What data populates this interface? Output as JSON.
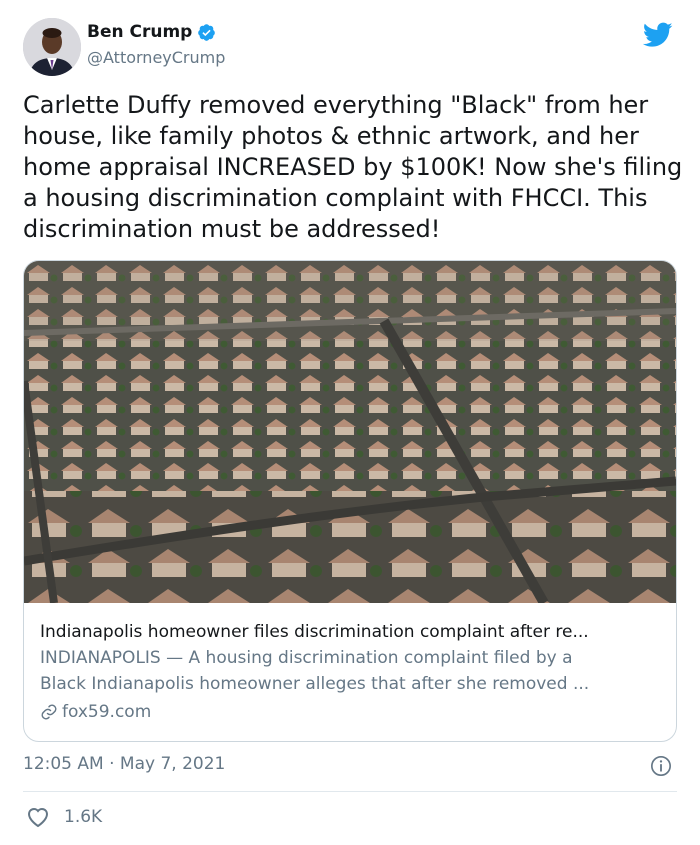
{
  "author": {
    "name": "Ben Crump",
    "handle": "@AttorneyCrump",
    "verified": true
  },
  "tweet": {
    "text": "Carlette Duffy removed everything \"Black\" from her house, like family photos & ethnic artwork, and her home appraisal INCREASED by $100K! Now she's filing a housing discrimination complaint with FHCCI. This discrimination must be addressed!"
  },
  "card": {
    "image_description": "aerial-view-of-suburban-houses",
    "title": "Indianapolis homeowner files discrimination complaint after re...",
    "description_line1": "INDIANAPOLIS — A housing discrimination complaint filed by a",
    "description_line2": "Black Indianapolis homeowner alleges that after she removed ...",
    "domain": "fox59.com"
  },
  "meta": {
    "timestamp": "12:05 AM · May 7, 2021"
  },
  "engagement": {
    "likes": "1.6K"
  },
  "colors": {
    "brand": "#1da1f2",
    "text": "#14171a",
    "secondary": "#657786",
    "border": "#ccd6dd"
  },
  "icons": [
    "verified-badge-icon",
    "twitter-bird-icon",
    "link-icon",
    "info-icon",
    "heart-icon"
  ]
}
